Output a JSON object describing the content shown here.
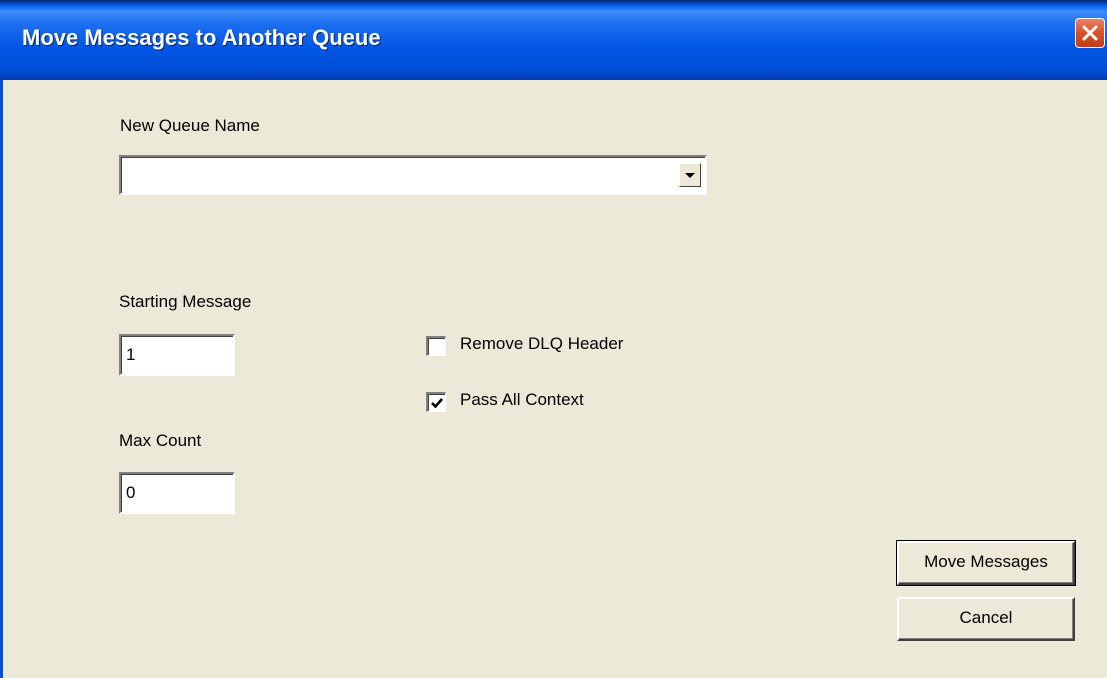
{
  "window": {
    "title": "Move Messages to Another Queue"
  },
  "form": {
    "queue_name_label": "New Queue Name",
    "queue_name_value": "",
    "starting_message_label": "Starting Message",
    "starting_message_value": "1",
    "max_count_label": "Max Count",
    "max_count_value": "0",
    "remove_dlq_label": "Remove DLQ Header",
    "remove_dlq_checked": false,
    "pass_context_label": "Pass All Context",
    "pass_context_checked": true
  },
  "buttons": {
    "move_label": "Move Messages",
    "cancel_label": "Cancel"
  },
  "icons": {
    "close": "close-icon",
    "dropdown": "chevron-down-icon",
    "check": "checkmark-icon"
  },
  "colors": {
    "titlebar": "#0055e5",
    "close_button": "#d9542b",
    "dialog_background": "#ece9d8"
  }
}
